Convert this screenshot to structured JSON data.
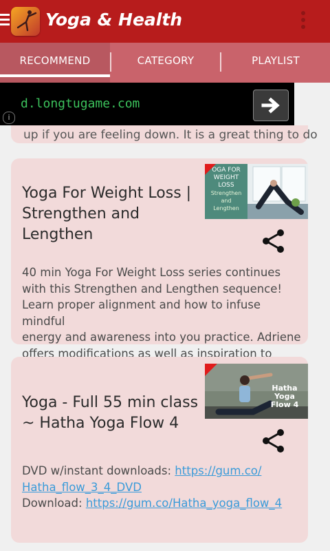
{
  "app": {
    "title": "Yoga & Health"
  },
  "tabs": [
    {
      "label": "RECOMMEND",
      "active": true
    },
    {
      "label": "CATEGORY",
      "active": false
    },
    {
      "label": "PLAYLIST",
      "active": false
    }
  ],
  "ad": {
    "url": "d.longtugame.com",
    "info": "i"
  },
  "previous_card": {
    "text": "up if you are feeling down. It is a great thing to do"
  },
  "cards": [
    {
      "title_lines": [
        "Yoga For Weight Loss |",
        "Strengthen and",
        "Lengthen"
      ],
      "thumbnail_text": [
        "OGA FOR",
        "WEIGHT",
        "LOSS",
        "Strengthen",
        "and",
        "Lengthen"
      ],
      "description_lines": [
        "40 min Yoga For Weight Loss series continues",
        "with this Strengthen and Lengthen sequence!",
        "Learn proper alignment and how to infuse mindful",
        "energy and awareness into you practice. Adriene",
        "offers modifications as well as inspiration to detail"
      ]
    },
    {
      "title_lines": [
        "Yoga - Full 55 min class",
        "~ Hatha Yoga Flow 4"
      ],
      "thumbnail_text": [
        "Hatha",
        "Yoga",
        "Flow 4"
      ],
      "desc_line1": "DVD w/instant downloads: ",
      "link1_a": "https://gum.co/",
      "link1_b": "Hatha_flow_3_4_DVD",
      "desc_line3": "Download: ",
      "link2": "https://gum.co/Hatha_yoga_flow_4"
    }
  ],
  "colors": {
    "appbar": "#b71c1c",
    "tabs": "#c9636b",
    "card": "#f2dada",
    "link": "#3a9bd9"
  },
  "icons": [
    "menu-icon",
    "app-logo-icon",
    "overflow-menu-icon",
    "arrow-right-icon",
    "info-icon",
    "share-icon"
  ]
}
